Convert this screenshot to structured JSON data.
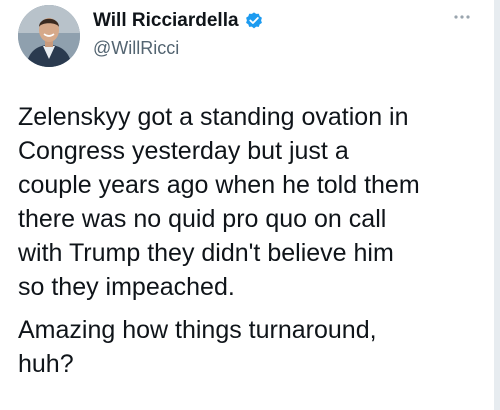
{
  "tweet": {
    "author": {
      "display_name": "Will Ricciardella",
      "handle": "@WillRicci",
      "verified": true,
      "avatar_icon": "profile-photo"
    },
    "menu_icon": "more-horizontal-icon",
    "paragraphs": [
      "Zelenskyy got a standing ovation in\nCongress yesterday but just a\ncouple years ago when he told them\nthere was no quid pro quo on call\nwith Trump they didn't believe him\nso they impeached.",
      "Amazing how things turnaround,\nhuh?"
    ],
    "colors": {
      "text": "#0f1419",
      "secondary_text": "#536471",
      "verified_badge": "#1d9bf0"
    }
  }
}
